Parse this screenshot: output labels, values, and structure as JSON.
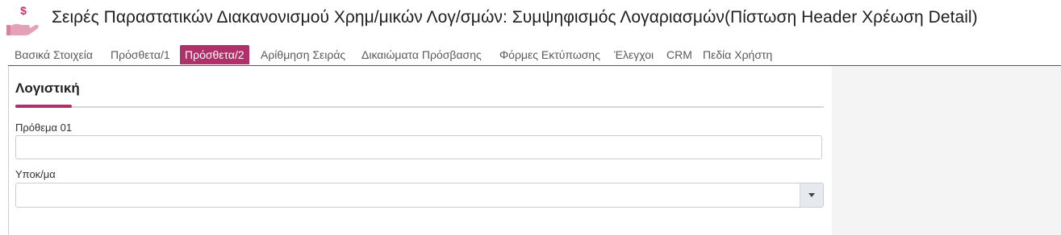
{
  "header": {
    "title": "Σειρές Παραστατικών Διακανονισμού Χρημ/μικών Λογ/σμών: Συμψηφισμός Λογαριασμών(Πίστωση Header Χρέωση Detail)",
    "icon": "hand-money-icon",
    "icon_color": "#c2326e"
  },
  "tabs": [
    {
      "label": "Βασικά Στοιχεία",
      "active": false
    },
    {
      "label": "Πρόσθετα/1",
      "active": false
    },
    {
      "label": "Πρόσθετα/2",
      "active": true
    },
    {
      "label": "Αρίθμηση Σειράς",
      "active": false
    },
    {
      "label": "Δικαιώματα Πρόσβασης",
      "active": false
    },
    {
      "label": "Φόρμες Εκτύπωσης",
      "active": false
    },
    {
      "label": "Έλεγχοι",
      "active": false
    },
    {
      "label": "CRM",
      "active": false
    },
    {
      "label": "Πεδία Χρήστη",
      "active": false
    }
  ],
  "colors": {
    "accent": "#b0306a",
    "tab_text": "#5a5a5a"
  },
  "section": {
    "title": "Λογιστική"
  },
  "fields": {
    "prefix": {
      "label": "Πρόθεμα 01",
      "value": ""
    },
    "subaccount": {
      "label": "Υποκ/μα",
      "value": ""
    }
  }
}
